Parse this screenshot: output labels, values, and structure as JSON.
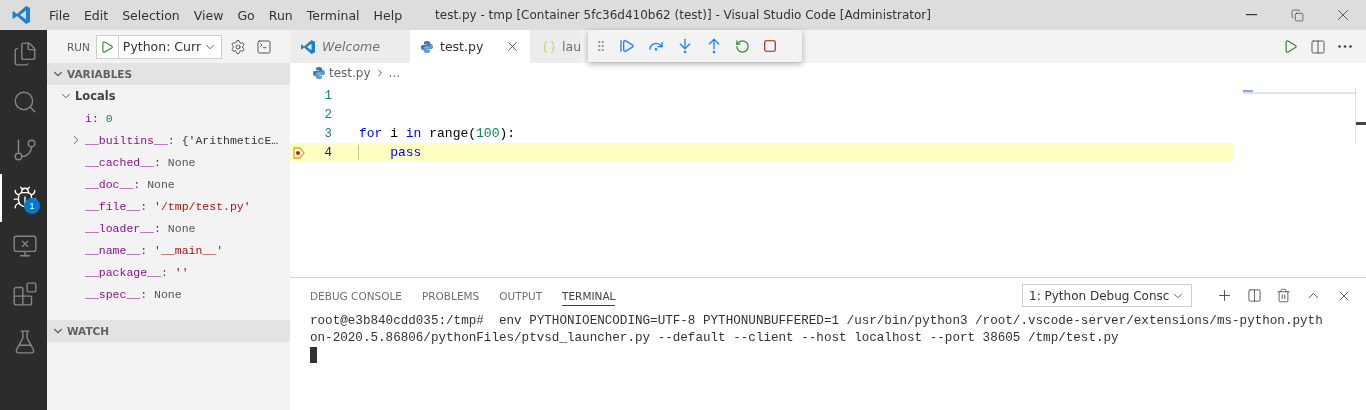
{
  "title_bar": {
    "menu": [
      "File",
      "Edit",
      "Selection",
      "View",
      "Go",
      "Run",
      "Terminal",
      "Help"
    ],
    "title": "test.py - tmp [Container 5fc36d410b62 (test)] - Visual Studio Code [Administrator]"
  },
  "activity_bar": [
    {
      "kind": "explorer",
      "selected": false
    },
    {
      "kind": "search",
      "selected": false
    },
    {
      "kind": "scm",
      "selected": false
    },
    {
      "kind": "debug",
      "selected": true,
      "badge": "1"
    },
    {
      "kind": "remote",
      "selected": false
    },
    {
      "kind": "extensions",
      "selected": false
    },
    {
      "kind": "testing",
      "selected": false
    }
  ],
  "run_view": {
    "label": "RUN",
    "configuration": "Python: Curr"
  },
  "variables": {
    "title": "VARIABLES",
    "expanded": true,
    "scopes": [
      {
        "name": "Locals",
        "expanded": true,
        "children": [
          {
            "name": "i:",
            "value": "0",
            "kind": "number",
            "expandable": false
          },
          {
            "name": "__builtins__:",
            "value": "{'ArithmeticE…",
            "kind": "object",
            "expandable": true
          },
          {
            "name": "__cached__:",
            "value": "None",
            "kind": "none",
            "expandable": false
          },
          {
            "name": "__doc__:",
            "value": "None",
            "kind": "none",
            "expandable": false
          },
          {
            "name": "__file__:",
            "value": "'/tmp/test.py'",
            "kind": "string",
            "expandable": false
          },
          {
            "name": "__loader__:",
            "value": "None",
            "kind": "none",
            "expandable": false
          },
          {
            "name": "__name__:",
            "value": "'__main__'",
            "kind": "string",
            "expandable": false
          },
          {
            "name": "__package__:",
            "value": "''",
            "kind": "string",
            "expandable": false
          },
          {
            "name": "__spec__:",
            "value": "None",
            "kind": "none",
            "expandable": false
          }
        ]
      }
    ]
  },
  "watch": {
    "title": "WATCH",
    "expanded": true
  },
  "tabs": [
    {
      "label": "Welcome",
      "kind": "welcome",
      "selected": false
    },
    {
      "label": "test.py",
      "kind": "python",
      "selected": true
    },
    {
      "label": "lau",
      "kind": "json",
      "selected": false
    }
  ],
  "breadcrumb": [
    "test.py",
    "..."
  ],
  "code_lines": [
    {
      "number": "1",
      "current": false
    },
    {
      "number": "2",
      "current": false
    },
    {
      "number": "3",
      "current": false,
      "tokens": [
        {
          "text": "for",
          "kind": "keyword"
        },
        {
          "text": " i ",
          "kind": "plain"
        },
        {
          "text": "in",
          "kind": "keyword"
        },
        {
          "text": " range(",
          "kind": "plain"
        },
        {
          "text": "100",
          "kind": "number"
        },
        {
          "text": "):",
          "kind": "plain"
        }
      ]
    },
    {
      "number": "4",
      "current": true,
      "tokens": [
        {
          "text": "    pass",
          "kind": "keyword"
        }
      ]
    }
  ],
  "panel": {
    "tabs": [
      {
        "label": "DEBUG CONSOLE",
        "selected": false
      },
      {
        "label": "PROBLEMS",
        "selected": false
      },
      {
        "label": "OUTPUT",
        "selected": false
      },
      {
        "label": "TERMINAL",
        "selected": true
      }
    ],
    "terminal_select": "1: Python Debug Consc",
    "terminal_lines": [
      "root@e3b840cdd035:/tmp#  env PYTHONIOENCODING=UTF-8 PYTHONUNBUFFERED=1 /usr/bin/python3 /root/.vscode-server/extensions/ms-python.pyth",
      "on-2020.5.86806/pythonFiles/ptvsd_launcher.py --default --client --host localhost --port 38605 /tmp/test.py"
    ]
  }
}
